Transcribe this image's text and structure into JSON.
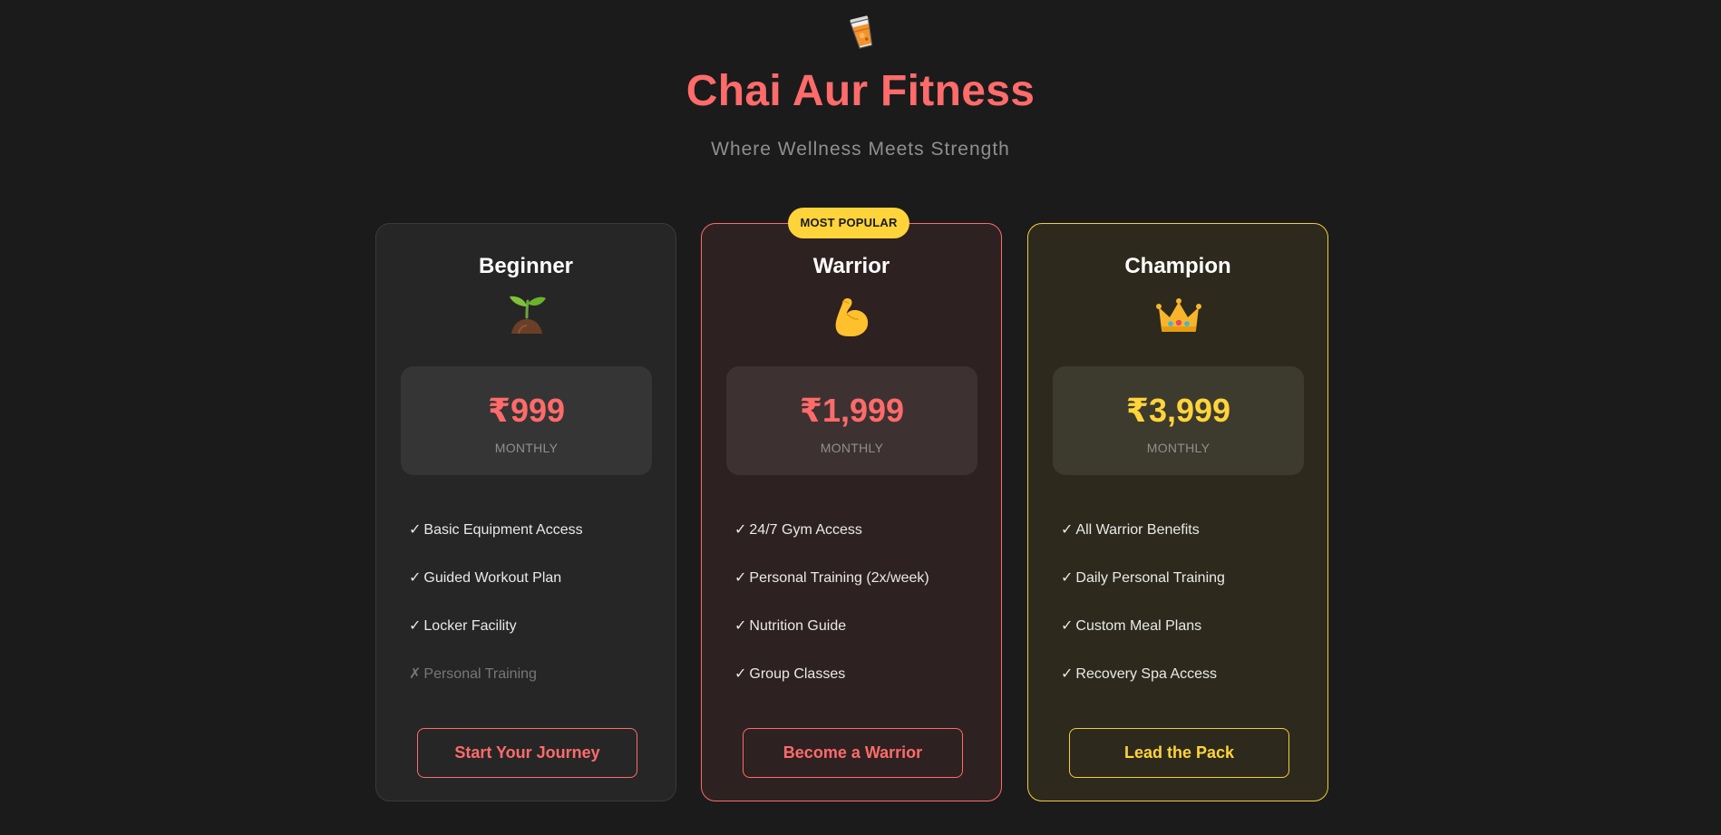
{
  "header": {
    "logo_icon": "chai-glass-icon",
    "title": "Chai Aur Fitness",
    "subtitle": "Where Wellness Meets Strength"
  },
  "colors": {
    "accent_red": "#ff6b6b",
    "accent_gold": "#ffd43b",
    "background": "#1b1b1b"
  },
  "plans": [
    {
      "name": "Beginner",
      "icon": "seedling-icon",
      "price": "₹999",
      "period": "MONTHLY",
      "features": [
        {
          "mark": "✓",
          "text": "Basic Equipment Access",
          "included": true
        },
        {
          "mark": "✓",
          "text": "Guided Workout Plan",
          "included": true
        },
        {
          "mark": "✓",
          "text": "Locker Facility",
          "included": true
        },
        {
          "mark": "✗",
          "text": "Personal Training",
          "included": false
        }
      ],
      "cta": "Start Your Journey"
    },
    {
      "name": "Warrior",
      "icon": "flexed-biceps-icon",
      "badge": "MOST POPULAR",
      "price": "₹1,999",
      "period": "MONTHLY",
      "features": [
        {
          "mark": "✓",
          "text": "24/7 Gym Access",
          "included": true
        },
        {
          "mark": "✓",
          "text": "Personal Training (2x/week)",
          "included": true
        },
        {
          "mark": "✓",
          "text": "Nutrition Guide",
          "included": true
        },
        {
          "mark": "✓",
          "text": "Group Classes",
          "included": true
        }
      ],
      "cta": "Become a Warrior"
    },
    {
      "name": "Champion",
      "icon": "crown-icon",
      "price": "₹3,999",
      "period": "MONTHLY",
      "features": [
        {
          "mark": "✓",
          "text": "All Warrior Benefits",
          "included": true
        },
        {
          "mark": "✓",
          "text": "Daily Personal Training",
          "included": true
        },
        {
          "mark": "✓",
          "text": "Custom Meal Plans",
          "included": true
        },
        {
          "mark": "✓",
          "text": "Recovery Spa Access",
          "included": true
        }
      ],
      "cta": "Lead the Pack"
    }
  ]
}
